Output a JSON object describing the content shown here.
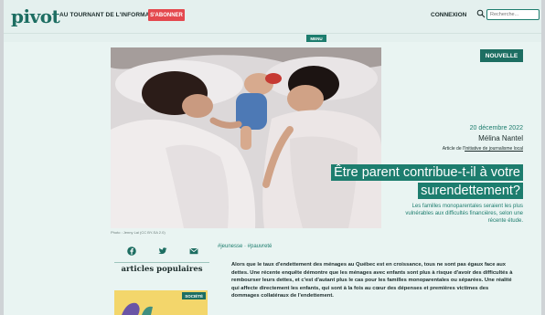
{
  "header": {
    "logo": "pivot",
    "tagline": "AU TOURNANT DE L'INFORMATION",
    "subscribe_label": "S'ABONNER",
    "login_label": "CONNEXION",
    "search_placeholder": "Recherche..."
  },
  "menu": {
    "label": "MENU"
  },
  "article": {
    "badge": "NOUVELLE",
    "date": "20 décembre 2022",
    "author": "Mélina Nantel",
    "note_prefix": "Article de l'",
    "note_link": "Initiative de journalisme local",
    "title": "Être parent contribue-t-il à votre surendettement?",
    "lede": "Les familles monoparentales seraient les plus vulnérables aux difficultés financières, selon une récente étude.",
    "photo_credit": "Photo : Jenny Lai (CC BY-SA 2.0)",
    "tags": "#jeunesse · #pauvreté",
    "body": "Alors que le taux d'endettement des ménages au Québec est en croissance, tous ne sont pas égaux face aux dettes. Une récente enquête démontre que les ménages avec enfants sont plus à risque d'avoir des difficultés à rembourser leurs dettes, et c'est d'autant plus le cas pour les familles monoparentales ou séparées. Une réalité qui affecte directement les enfants, qui sont à la fois au cœur des dépenses et premières victimes des dommages collatéraux de l'endettement."
  },
  "sidebar": {
    "share_icons": [
      "facebook-icon",
      "twitter-icon",
      "email-icon"
    ],
    "popular_title": "articles populaires",
    "thumb_badge": "SOCIÉTÉ"
  },
  "colors": {
    "brand": "#1d7d6e",
    "accent": "#e4484e",
    "header_bg": "#e4f0ee"
  }
}
